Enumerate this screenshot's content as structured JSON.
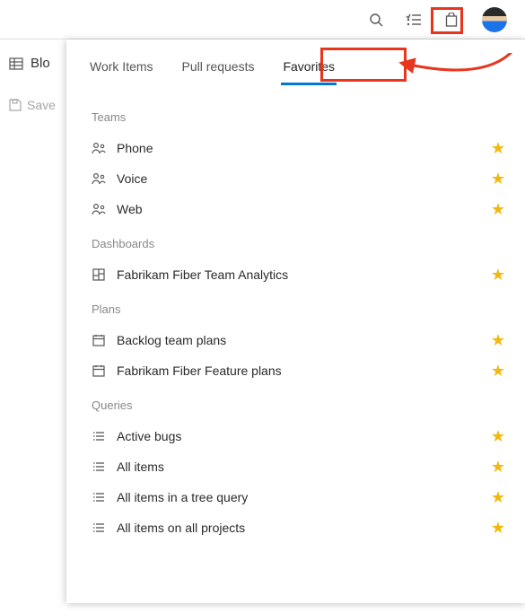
{
  "topbar": {
    "search_icon": "search",
    "list_icon": "list",
    "marketplace_icon": "shopping-bag",
    "avatar": "user-avatar"
  },
  "left": {
    "grid_label": "Blo",
    "save_label": "Save"
  },
  "panel": {
    "tabs": [
      {
        "label": "Work Items",
        "active": false
      },
      {
        "label": "Pull requests",
        "active": false
      },
      {
        "label": "Favorites",
        "active": true
      }
    ],
    "sections": [
      {
        "title": "Teams",
        "icon": "team",
        "items": [
          {
            "label": "Phone"
          },
          {
            "label": "Voice"
          },
          {
            "label": "Web"
          }
        ]
      },
      {
        "title": "Dashboards",
        "icon": "dashboard",
        "items": [
          {
            "label": "Fabrikam Fiber Team Analytics"
          }
        ]
      },
      {
        "title": "Plans",
        "icon": "plan",
        "items": [
          {
            "label": "Backlog team plans"
          },
          {
            "label": "Fabrikam Fiber Feature plans"
          }
        ]
      },
      {
        "title": "Queries",
        "icon": "query",
        "items": [
          {
            "label": "Active bugs"
          },
          {
            "label": "All items"
          },
          {
            "label": "All items in a tree query"
          },
          {
            "label": "All items on all projects"
          }
        ]
      }
    ]
  }
}
